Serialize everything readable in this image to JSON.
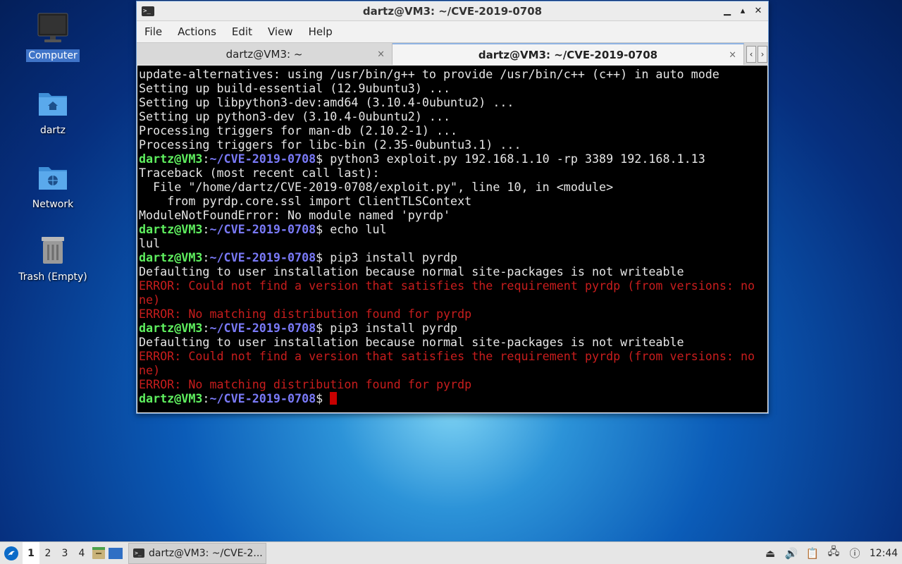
{
  "desktop": {
    "icons": [
      {
        "label": "Computer",
        "icon": "computer-icon"
      },
      {
        "label": "dartz",
        "icon": "home-folder-icon"
      },
      {
        "label": "Network",
        "icon": "network-folder-icon"
      },
      {
        "label": "Trash (Empty)",
        "icon": "trash-icon"
      }
    ]
  },
  "window": {
    "title": "dartz@VM3: ~/CVE-2019-0708",
    "menu": [
      "File",
      "Actions",
      "Edit",
      "View",
      "Help"
    ],
    "tabs": [
      {
        "label": "dartz@VM3: ~",
        "active": false
      },
      {
        "label": "dartz@VM3: ~/CVE-2019-0708",
        "active": true
      }
    ],
    "tab_close": "×",
    "tab_prev": "‹",
    "tab_next": "›"
  },
  "terminal": {
    "prompt_user": "dartz@VM3",
    "prompt_path": "~/CVE-2019-0708",
    "lines": [
      {
        "kind": "out",
        "text": "update-alternatives: using /usr/bin/g++ to provide /usr/bin/c++ (c++) in auto mode"
      },
      {
        "kind": "out",
        "text": "Setting up build-essential (12.9ubuntu3) ..."
      },
      {
        "kind": "out",
        "text": "Setting up libpython3-dev:amd64 (3.10.4-0ubuntu2) ..."
      },
      {
        "kind": "out",
        "text": "Setting up python3-dev (3.10.4-0ubuntu2) ..."
      },
      {
        "kind": "out",
        "text": "Processing triggers for man-db (2.10.2-1) ..."
      },
      {
        "kind": "out",
        "text": "Processing triggers for libc-bin (2.35-0ubuntu3.1) ..."
      },
      {
        "kind": "cmd",
        "text": "python3 exploit.py 192.168.1.10 -rp 3389 192.168.1.13"
      },
      {
        "kind": "out",
        "text": "Traceback (most recent call last):"
      },
      {
        "kind": "out",
        "text": "  File \"/home/dartz/CVE-2019-0708/exploit.py\", line 10, in <module>"
      },
      {
        "kind": "out",
        "text": "    from pyrdp.core.ssl import ClientTLSContext"
      },
      {
        "kind": "out",
        "text": "ModuleNotFoundError: No module named 'pyrdp'"
      },
      {
        "kind": "cmd",
        "text": "echo lul"
      },
      {
        "kind": "out",
        "text": "lul"
      },
      {
        "kind": "cmd",
        "text": "pip3 install pyrdp"
      },
      {
        "kind": "out",
        "text": "Defaulting to user installation because normal site-packages is not writeable"
      },
      {
        "kind": "err",
        "text": "ERROR: Could not find a version that satisfies the requirement pyrdp (from versions: no"
      },
      {
        "kind": "err",
        "text": "ne)"
      },
      {
        "kind": "err",
        "text": "ERROR: No matching distribution found for pyrdp"
      },
      {
        "kind": "cmd",
        "text": "pip3 install pyrdp"
      },
      {
        "kind": "out",
        "text": "Defaulting to user installation because normal site-packages is not writeable"
      },
      {
        "kind": "err",
        "text": "ERROR: Could not find a version that satisfies the requirement pyrdp (from versions: no"
      },
      {
        "kind": "err",
        "text": "ne)"
      },
      {
        "kind": "err",
        "text": "ERROR: No matching distribution found for pyrdp"
      },
      {
        "kind": "prompt",
        "text": ""
      }
    ]
  },
  "taskbar": {
    "workspaces": [
      "1",
      "2",
      "3",
      "4"
    ],
    "active_workspace": "1",
    "task_label": "dartz@VM3: ~/CVE-2...",
    "clock": "12:44"
  },
  "colors": {
    "prompt_user": "#5ff05f",
    "prompt_path": "#7a7af8",
    "error": "#c81d1d",
    "cursor": "#c80000"
  }
}
